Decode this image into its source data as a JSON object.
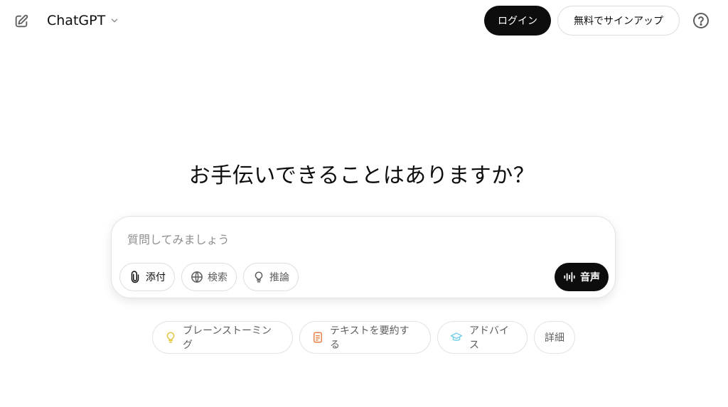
{
  "header": {
    "new_chat_icon": "edit-square-icon",
    "model_name": "ChatGPT",
    "model_chevron_icon": "chevron-down-icon",
    "login_label": "ログイン",
    "signup_label": "無料でサインアップ",
    "help_icon": "question-circle-icon"
  },
  "main": {
    "headline": "お手伝いできることはありますか？"
  },
  "composer": {
    "placeholder": "質問してみましょう",
    "value": "",
    "tools": [
      {
        "label": "添付",
        "icon": "paperclip-icon"
      },
      {
        "label": "検索",
        "icon": "globe-icon"
      },
      {
        "label": "推論",
        "icon": "lightbulb-icon"
      }
    ],
    "voice_label": "音声",
    "voice_icon": "waveform-icon"
  },
  "suggestions": [
    {
      "label": "ブレーンストーミング",
      "icon": "lightbulb-icon",
      "color": "#e2c541"
    },
    {
      "label": "テキストを要約する",
      "icon": "document-icon",
      "color": "#e8844a"
    },
    {
      "label": "アドバイス",
      "icon": "graduation-cap-icon",
      "color": "#76d0eb"
    },
    {
      "label": "詳細"
    }
  ],
  "colors": {
    "primary": "#0d0d0d",
    "border": "#e3e3e3",
    "muted_text": "#5d5d5d",
    "placeholder": "#8f8f8f"
  }
}
